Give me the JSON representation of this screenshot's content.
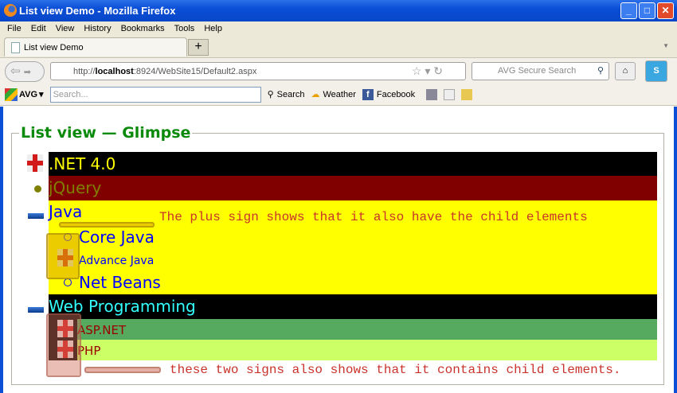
{
  "window": {
    "title": "List view Demo - Mozilla Firefox"
  },
  "menu": [
    "File",
    "Edit",
    "View",
    "History",
    "Bookmarks",
    "Tools",
    "Help"
  ],
  "tab": {
    "label": "List view Demo",
    "new_tab": "+"
  },
  "nav": {
    "url_prefix": "http://",
    "url_host": "localhost",
    "url_rest": ":8924/WebSite15/Default2.aspx",
    "search_placeholder": "AVG Secure Search"
  },
  "avg": {
    "logo": "AVG",
    "search_placeholder": "Search...",
    "search_label": "Search",
    "weather": "Weather",
    "facebook": "Facebook"
  },
  "page": {
    "legend": "List view — Glimpse",
    "items": {
      "net": ".NET 4.0",
      "jquery": "jQuery",
      "java": "Java",
      "core_java": "Core Java",
      "advance_java": "Advance Java",
      "net_beans": "Net Beans",
      "web": "Web Programming",
      "aspnet": "ASP.NET",
      "php": "PHP"
    },
    "note1": "The plus sign shows that it also have the child elements",
    "note2": "these two signs also shows that it contains child elements."
  },
  "colors": {
    "net_bg": "#000000",
    "net_fg": "#ffff00",
    "jquery_bg": "#800000",
    "jquery_fg": "#808000",
    "java_bg": "#ffff00",
    "java_fg": "#0000ff",
    "web_fg": "#33ffff",
    "asp_bg": "#55aa5f",
    "php_bg": "#ccff66",
    "note": "#c9332c"
  }
}
